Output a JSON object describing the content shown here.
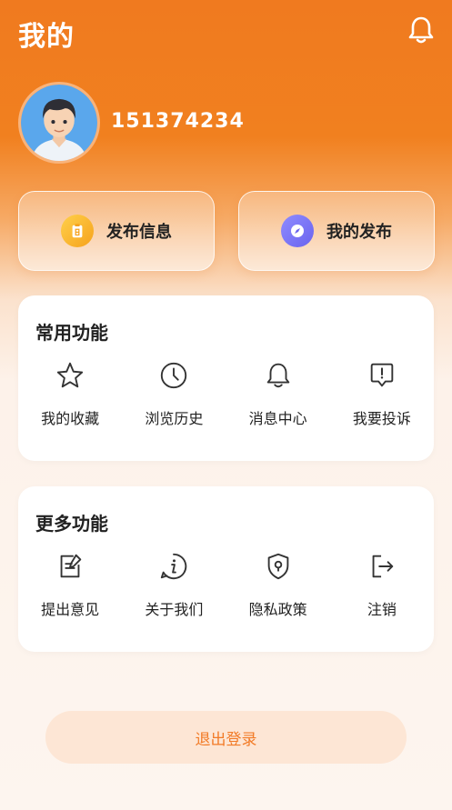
{
  "header": {
    "title": "我的",
    "bell_icon": "bell-icon"
  },
  "profile": {
    "username": "151374234",
    "avatar_icon": "avatar"
  },
  "actions": [
    {
      "label": "发布信息",
      "icon": "clipboard-icon",
      "color": "#f6a21c"
    },
    {
      "label": "我的发布",
      "icon": "compass-icon",
      "color": "#6a63ee"
    }
  ],
  "common": {
    "title": "常用功能",
    "items": [
      {
        "label": "我的收藏",
        "icon": "star-icon"
      },
      {
        "label": "浏览历史",
        "icon": "clock-icon"
      },
      {
        "label": "消息中心",
        "icon": "bell-icon"
      },
      {
        "label": "我要投诉",
        "icon": "complaint-icon"
      }
    ]
  },
  "more": {
    "title": "更多功能",
    "items": [
      {
        "label": "提出意见",
        "icon": "edit-note-icon"
      },
      {
        "label": "关于我们",
        "icon": "info-icon"
      },
      {
        "label": "隐私政策",
        "icon": "shield-icon"
      },
      {
        "label": "注销",
        "icon": "exit-icon"
      }
    ]
  },
  "logout": {
    "label": "退出登录"
  },
  "colors": {
    "accent": "#f07a1f",
    "logout_bg": "#fde6d5",
    "logout_text": "#f27b27"
  }
}
